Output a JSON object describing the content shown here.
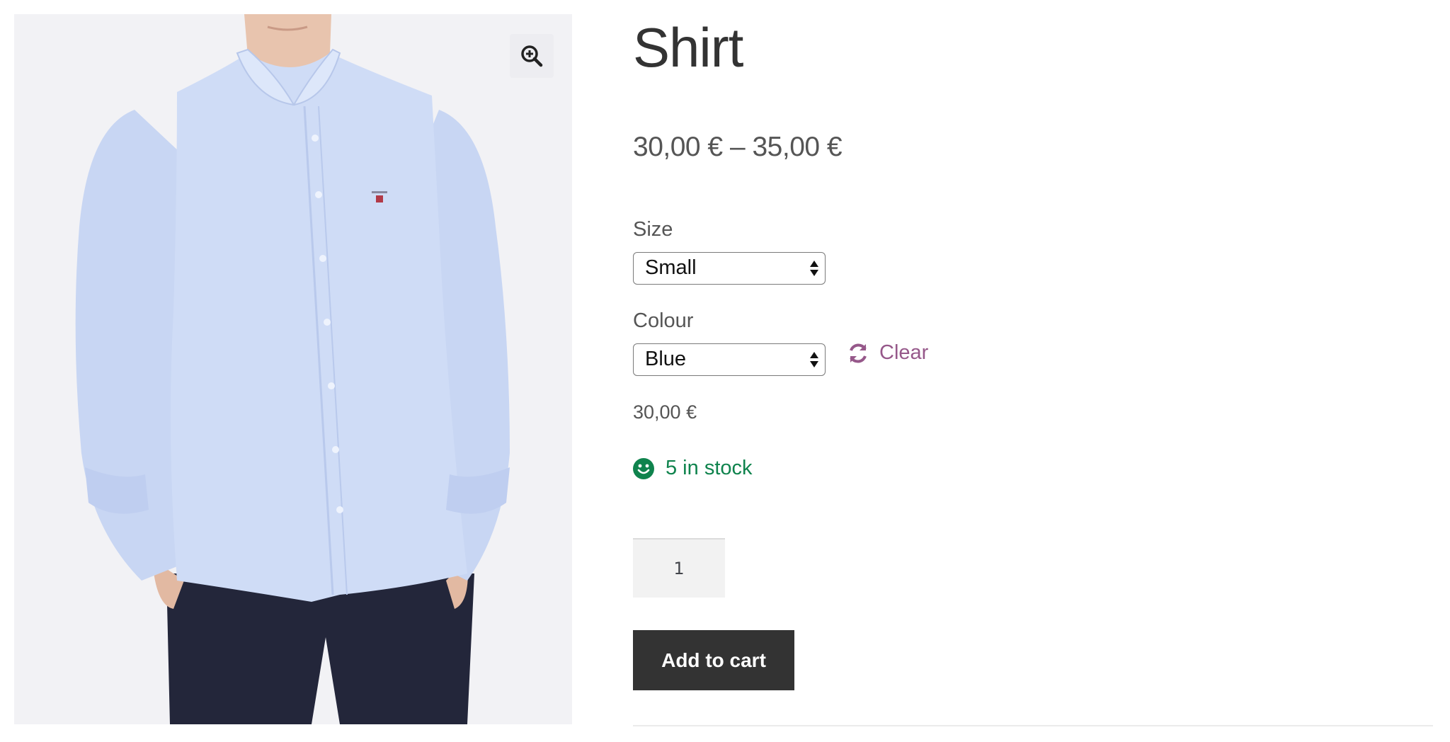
{
  "product": {
    "title": "Shirt",
    "price_range": "30,00 € – 35,00 €",
    "zoom_icon": "magnifier-plus-icon",
    "image_alt": "Blue shirt",
    "size": {
      "label": "Size",
      "value": "Small"
    },
    "colour": {
      "label": "Colour",
      "value": "Blue"
    },
    "clear_label": "Clear",
    "clear_icon": "refresh-icon",
    "variation_price": "30,00 €",
    "stock_text": "5 in stock",
    "stock_icon": "smiley-icon",
    "quantity": "1",
    "add_to_cart_label": "Add to cart"
  },
  "colors": {
    "accent": "#96588a",
    "stock_green": "#0f834d",
    "button_bg": "#333333",
    "shirt_blue": "#cfdcf6"
  }
}
